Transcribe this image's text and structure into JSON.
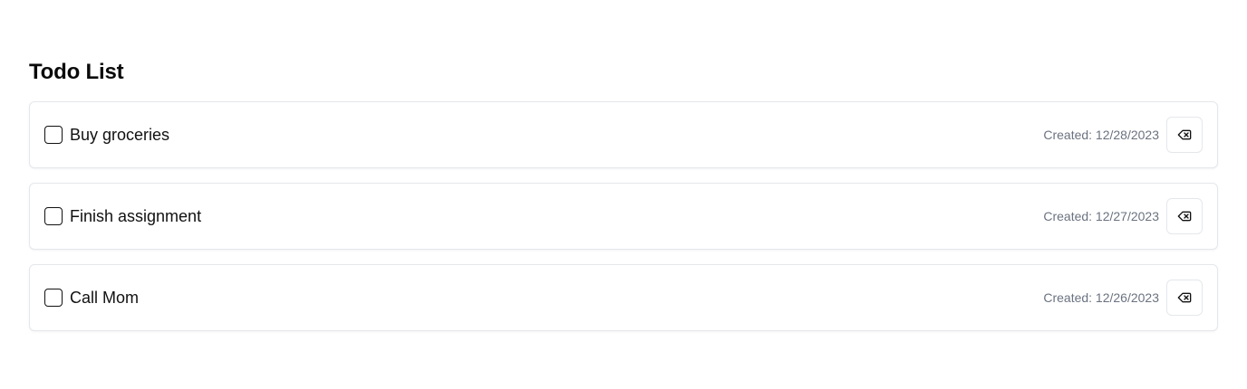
{
  "page": {
    "title": "Todo List"
  },
  "todos": [
    {
      "label": "Buy groceries",
      "created": "Created: 12/28/2023",
      "checked": false,
      "delete_icon": "delete-backspace-icon"
    },
    {
      "label": "Finish assignment",
      "created": "Created: 12/27/2023",
      "checked": false,
      "delete_icon": "delete-backspace-icon"
    },
    {
      "label": "Call Mom",
      "created": "Created: 12/26/2023",
      "checked": false,
      "delete_icon": "delete-backspace-icon"
    }
  ],
  "colors": {
    "border": "#e5e7eb",
    "muted_text": "#6b7280",
    "text": "#0a0a0a"
  }
}
